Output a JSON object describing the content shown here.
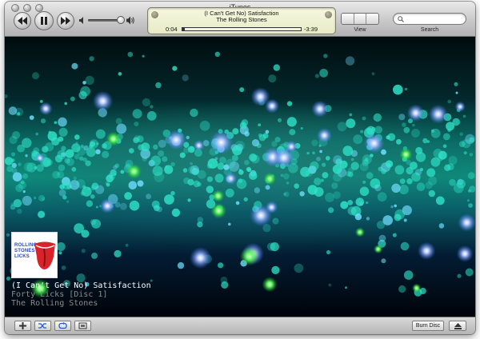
{
  "window": {
    "title": "iTunes"
  },
  "toolbar": {
    "view_label": "View",
    "search_label": "Search",
    "search_placeholder": "",
    "volume_level": 0.85
  },
  "lcd": {
    "song": "(I Can't Get No) Satisfaction",
    "artist": "The Rolling Stones",
    "elapsed": "0:04",
    "remaining": "-3:39",
    "progress": 0.02
  },
  "now_playing": {
    "title": "(I Can't Get No) Satisfaction",
    "album": "Forty Licks [Disc 1]",
    "artist": "The Rolling Stones",
    "album_art_text": "ROLLING STONES LICKS"
  },
  "bottom": {
    "burn_label": "Burn Disc"
  },
  "colors": {
    "accent_lcd": "#e8ebc7",
    "visualizer_cyan": "#2fe3c8",
    "visualizer_blue": "#3b6bff",
    "album_red": "#d8232a"
  },
  "icons": {
    "previous": "previous-track-icon",
    "play_pause": "pause-icon",
    "next": "next-track-icon",
    "add": "add-icon",
    "shuffle": "shuffle-icon",
    "repeat": "repeat-icon",
    "artwork": "show-artwork-icon",
    "eject": "eject-icon"
  }
}
